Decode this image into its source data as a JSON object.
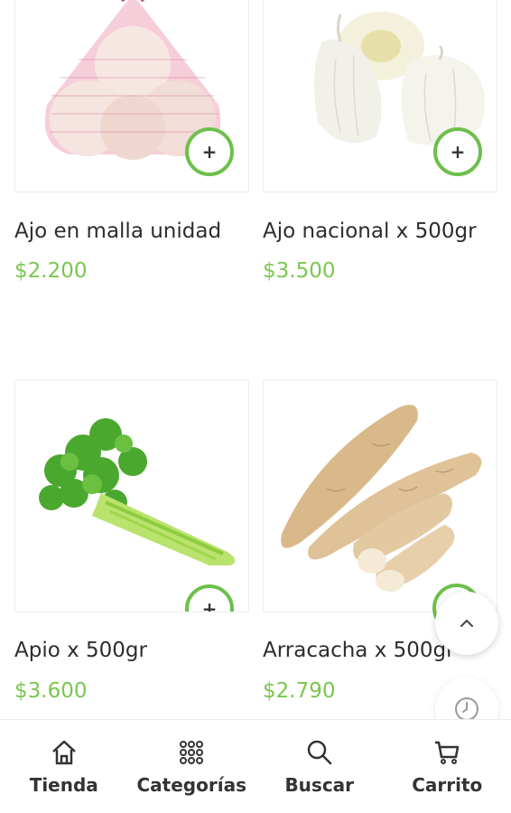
{
  "products": [
    {
      "name": "Ajo en malla unidad",
      "price": "$2.200",
      "add_label": "+"
    },
    {
      "name": "Ajo nacional x 500gr",
      "price": "$3.500",
      "add_label": "+"
    },
    {
      "name": "Apio x 500gr",
      "price": "$3.600",
      "add_label": "+"
    },
    {
      "name": "Arracacha x 500gr",
      "price": "$2.790",
      "add_label": "+"
    }
  ],
  "nav": {
    "items": [
      {
        "label": "Tienda",
        "icon": "home-icon"
      },
      {
        "label": "Categorías",
        "icon": "grid-icon"
      },
      {
        "label": "Buscar",
        "icon": "search-icon"
      },
      {
        "label": "Carrito",
        "icon": "cart-icon"
      }
    ]
  },
  "colors": {
    "accent": "#6cc04a",
    "price": "#7ac74f"
  }
}
